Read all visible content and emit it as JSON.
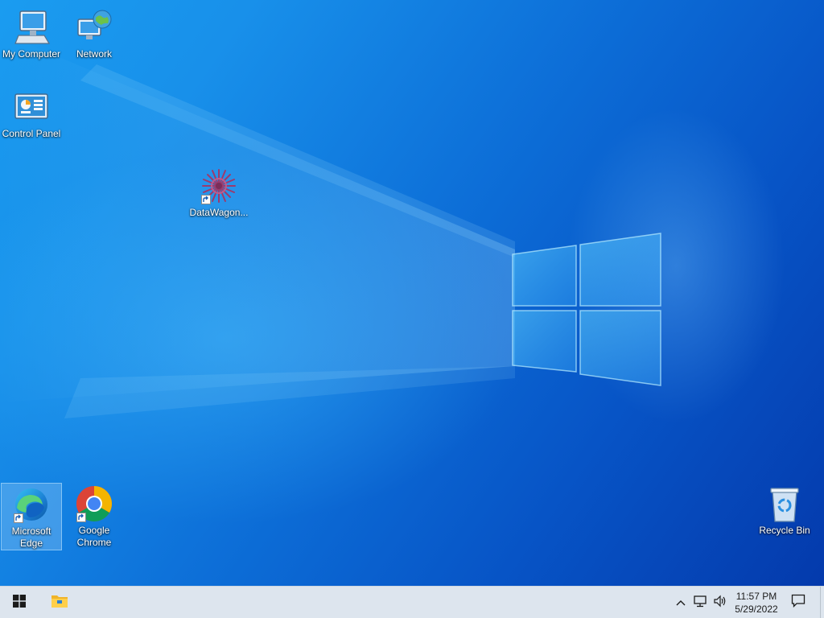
{
  "desktop": {
    "icons": [
      {
        "label": "My Computer",
        "icon": "computer-icon"
      },
      {
        "label": "Network",
        "icon": "network-icon"
      },
      {
        "label": "Control Panel",
        "icon": "control-panel-icon"
      },
      {
        "label": "DataWagon...",
        "icon": "datawagon-icon",
        "shortcut": true
      },
      {
        "label": "Microsoft Edge",
        "label_lines": [
          "Microsoft",
          "Edge"
        ],
        "icon": "edge-icon",
        "shortcut": true,
        "selected": true
      },
      {
        "label": "Google Chrome",
        "label_lines": [
          "Google",
          "Chrome"
        ],
        "icon": "chrome-icon",
        "shortcut": true
      },
      {
        "label": "Recycle Bin",
        "icon": "recycle-bin-icon"
      }
    ]
  },
  "taskbar": {
    "start": {
      "icon": "windows-logo-icon"
    },
    "pinned": [
      {
        "icon": "file-explorer-icon",
        "name": "File Explorer"
      }
    ],
    "tray": {
      "icons": [
        "chevron-up-icon",
        "network-tray-icon",
        "volume-icon"
      ],
      "time": "11:57 PM",
      "date": "5/29/2022",
      "notification_icon": "action-center-icon"
    }
  },
  "colors": {
    "wallpaper_light": "#1a9cf0",
    "wallpaper_dark": "#0438aa",
    "taskbar_bg": "#dde5ee"
  }
}
